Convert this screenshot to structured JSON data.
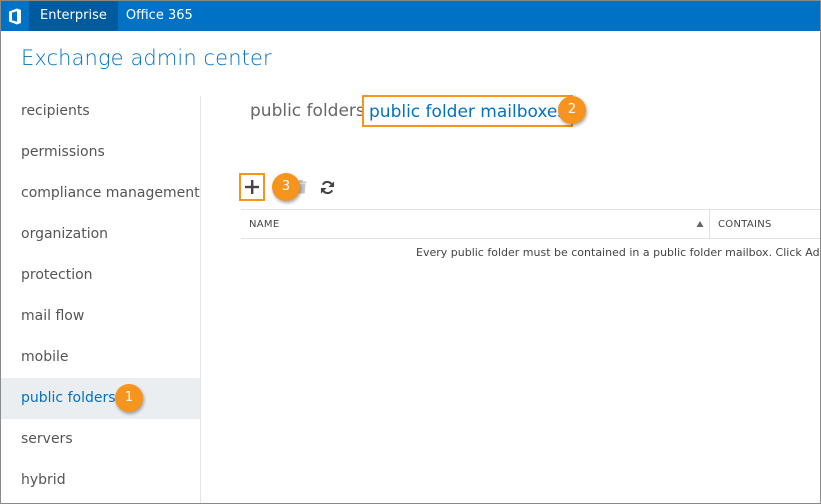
{
  "topbar": {
    "logo_icon": "office-logo-icon",
    "tabs": [
      {
        "label": "Enterprise",
        "active": true
      },
      {
        "label": "Office 365",
        "active": false
      }
    ]
  },
  "app": {
    "title": "Exchange admin center"
  },
  "sidebar": {
    "items": [
      {
        "label": "recipients"
      },
      {
        "label": "permissions"
      },
      {
        "label": "compliance management"
      },
      {
        "label": "organization"
      },
      {
        "label": "protection"
      },
      {
        "label": "mail flow"
      },
      {
        "label": "mobile"
      },
      {
        "label": "public folders",
        "selected": true
      },
      {
        "label": "servers"
      },
      {
        "label": "hybrid"
      }
    ]
  },
  "content": {
    "tabs": [
      {
        "label": "public folders"
      },
      {
        "label": "public folder mailboxes"
      }
    ],
    "toolbar": {
      "add_icon": "plus-icon",
      "delete_icon": "trash-icon",
      "refresh_icon": "refresh-icon"
    },
    "table": {
      "columns": [
        {
          "label": "NAME",
          "sort": "ascending"
        },
        {
          "label": "CONTAINS"
        }
      ],
      "empty_message": "Every public folder must be contained in a public folder mailbox. Click Add + to create a public folder mailbox."
    }
  },
  "callouts": {
    "one": "1",
    "two": "2",
    "three": "3"
  },
  "colors": {
    "brand_blue": "#0072c6",
    "topbar_active": "#005a9e",
    "callout_orange": "#f7941d",
    "selected_bg": "#eaeef0"
  }
}
